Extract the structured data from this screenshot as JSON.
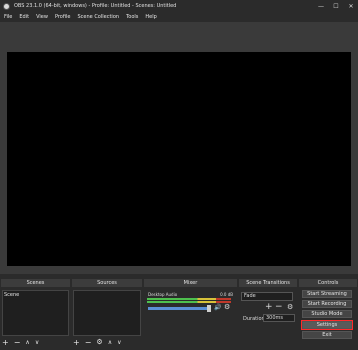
{
  "window": {
    "title": "OBS 23.1.0 (64-bit, windows) - Profile: Untitled - Scenes: Untitled",
    "minimize": "—",
    "maximize": "☐",
    "close": "✕"
  },
  "menu": [
    "File",
    "Edit",
    "View",
    "Profile",
    "Scene Collection",
    "Tools",
    "Help"
  ],
  "docks": {
    "scenes": {
      "title": "Scenes",
      "items": [
        "Scene"
      ]
    },
    "sources": {
      "title": "Sources"
    },
    "mixer": {
      "title": "Mixer",
      "channel": "Desktop Audio",
      "level": "0.0 dB"
    },
    "transitions": {
      "title": "Scene Transitions",
      "selected": "Fade",
      "duration_label": "Duration",
      "duration_value": "300ms"
    },
    "controls": {
      "title": "Controls",
      "buttons": [
        "Start Streaming",
        "Start Recording",
        "Studio Mode",
        "Settings",
        "Exit"
      ]
    }
  },
  "icons": {
    "add": "+",
    "remove": "−",
    "up": "∧",
    "down": "∨",
    "gear": "⚙",
    "speaker": "🔊"
  },
  "colors": {
    "highlight": "#ff2a2a",
    "meter_green": "#4ec04e",
    "meter_yellow": "#d8c23a",
    "meter_red": "#c0392b",
    "volume_blue": "#5a8fd6"
  }
}
